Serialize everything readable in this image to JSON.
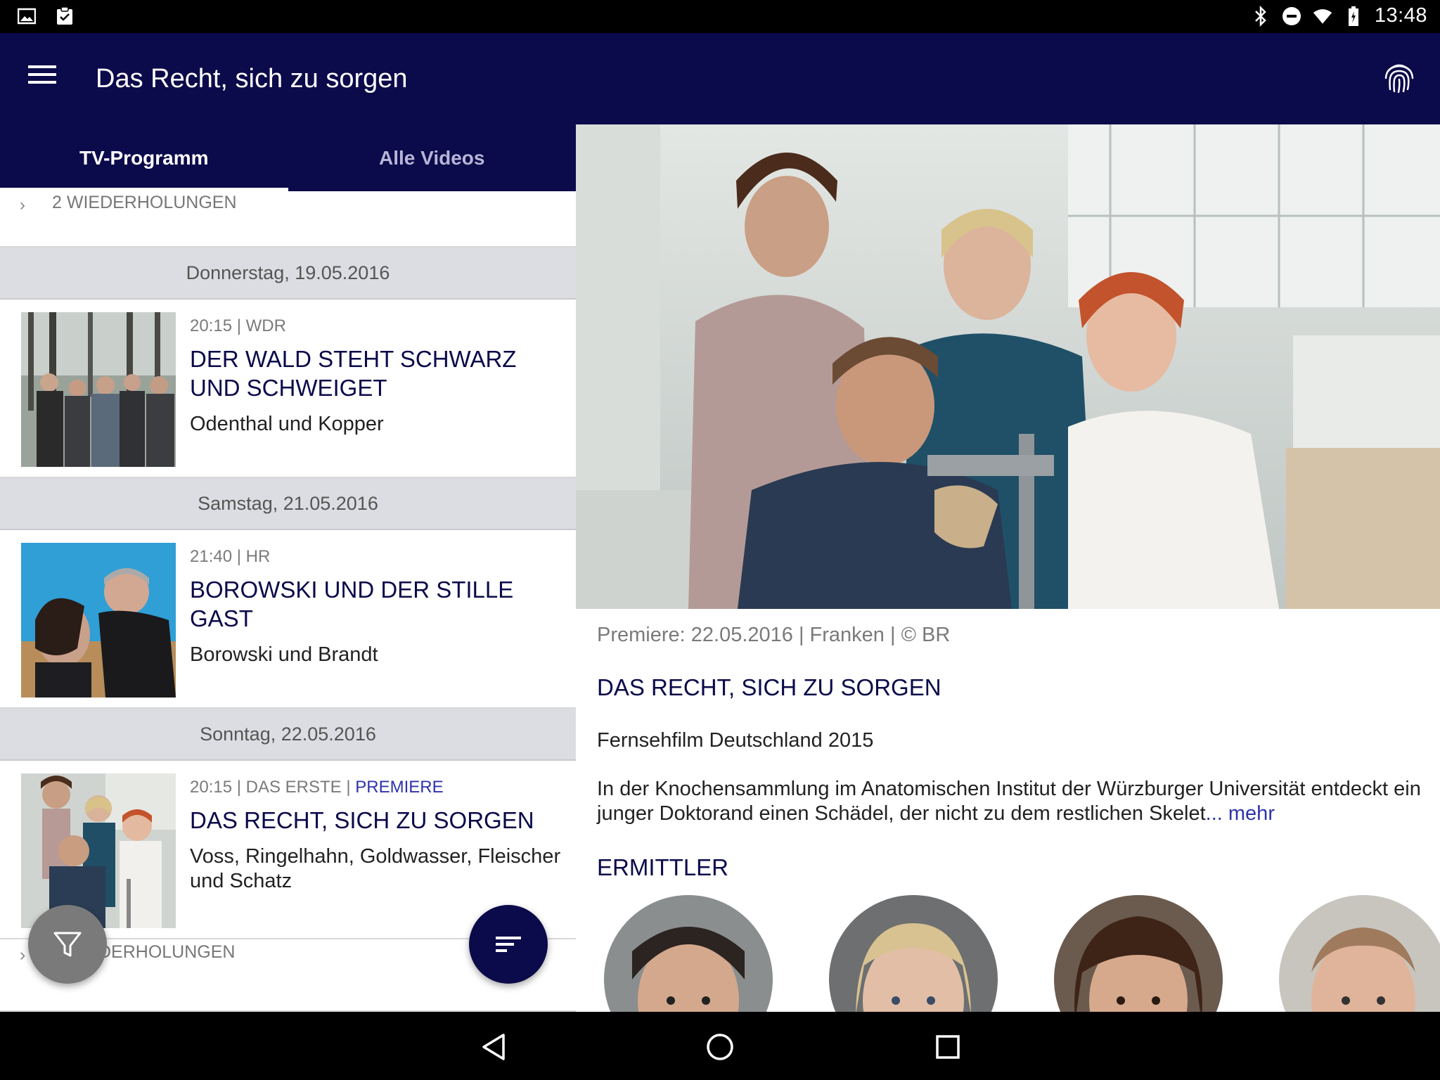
{
  "status_bar": {
    "time": "13:48",
    "left_icons": [
      "image-icon",
      "clipboard-icon"
    ],
    "right_icons": [
      "bluetooth-icon",
      "do-not-disturb-icon",
      "wifi-icon",
      "battery-icon"
    ]
  },
  "app_bar": {
    "title": "Das Recht, sich zu sorgen",
    "menu_icon": "hamburger-menu-icon",
    "action_icon": "fingerprint-icon",
    "background": "#0b0a4a"
  },
  "tabs": [
    {
      "label": "TV-Programm",
      "active": true
    },
    {
      "label": "Alle Videos",
      "active": false
    }
  ],
  "schedule": {
    "top_repeats": "2 WIEDERHOLUNGEN",
    "days": [
      {
        "date": "Donnerstag, 19.05.2016",
        "item": {
          "time_channel": "20:15 | WDR",
          "premiere": "",
          "title": "DER WALD STEHT SCHWARZ UND SCHWEIGET",
          "investigators": "Odenthal und Kopper"
        }
      },
      {
        "date": "Samstag, 21.05.2016",
        "item": {
          "time_channel": "21:40 | HR",
          "premiere": "",
          "title": "BOROWSKI UND DER STILLE GAST",
          "investigators": "Borowski und Brandt"
        }
      },
      {
        "date": "Sonntag, 22.05.2016",
        "item": {
          "time_channel": "20:15 | DAS ERSTE | ",
          "premiere": "PREMIERE",
          "title": "DAS RECHT, SICH ZU SORGEN",
          "investigators": "Voss, Ringelhahn, Goldwasser, Fleischer und Schatz"
        }
      }
    ],
    "bottom_repeats": "DERHOLUNGEN"
  },
  "fabs": {
    "filter_icon": "filter-icon",
    "sort_icon": "sort-icon"
  },
  "detail": {
    "meta": "Premiere: 22.05.2016 | Franken | © BR",
    "title": "DAS RECHT, SICH ZU SORGEN",
    "genre": "Fernsehfilm Deutschland 2015",
    "description": "In der Knochensammlung im Anatomischen Institut der Würzburger Universität entdeckt ein junger Doktorand einen Schädel, der nicht zu dem restlichen Skelet",
    "more_label": "... mehr",
    "section_investigators": "ERMITTLER",
    "investigator_count": 4
  },
  "nav_bar": {
    "icons": [
      "back-icon",
      "home-icon",
      "recents-icon"
    ]
  },
  "colors": {
    "brand_dark": "#0b0a4a",
    "link_blue": "#2e33a9",
    "day_header": "#dcdde2",
    "fab_grey": "#7a7a7a"
  }
}
